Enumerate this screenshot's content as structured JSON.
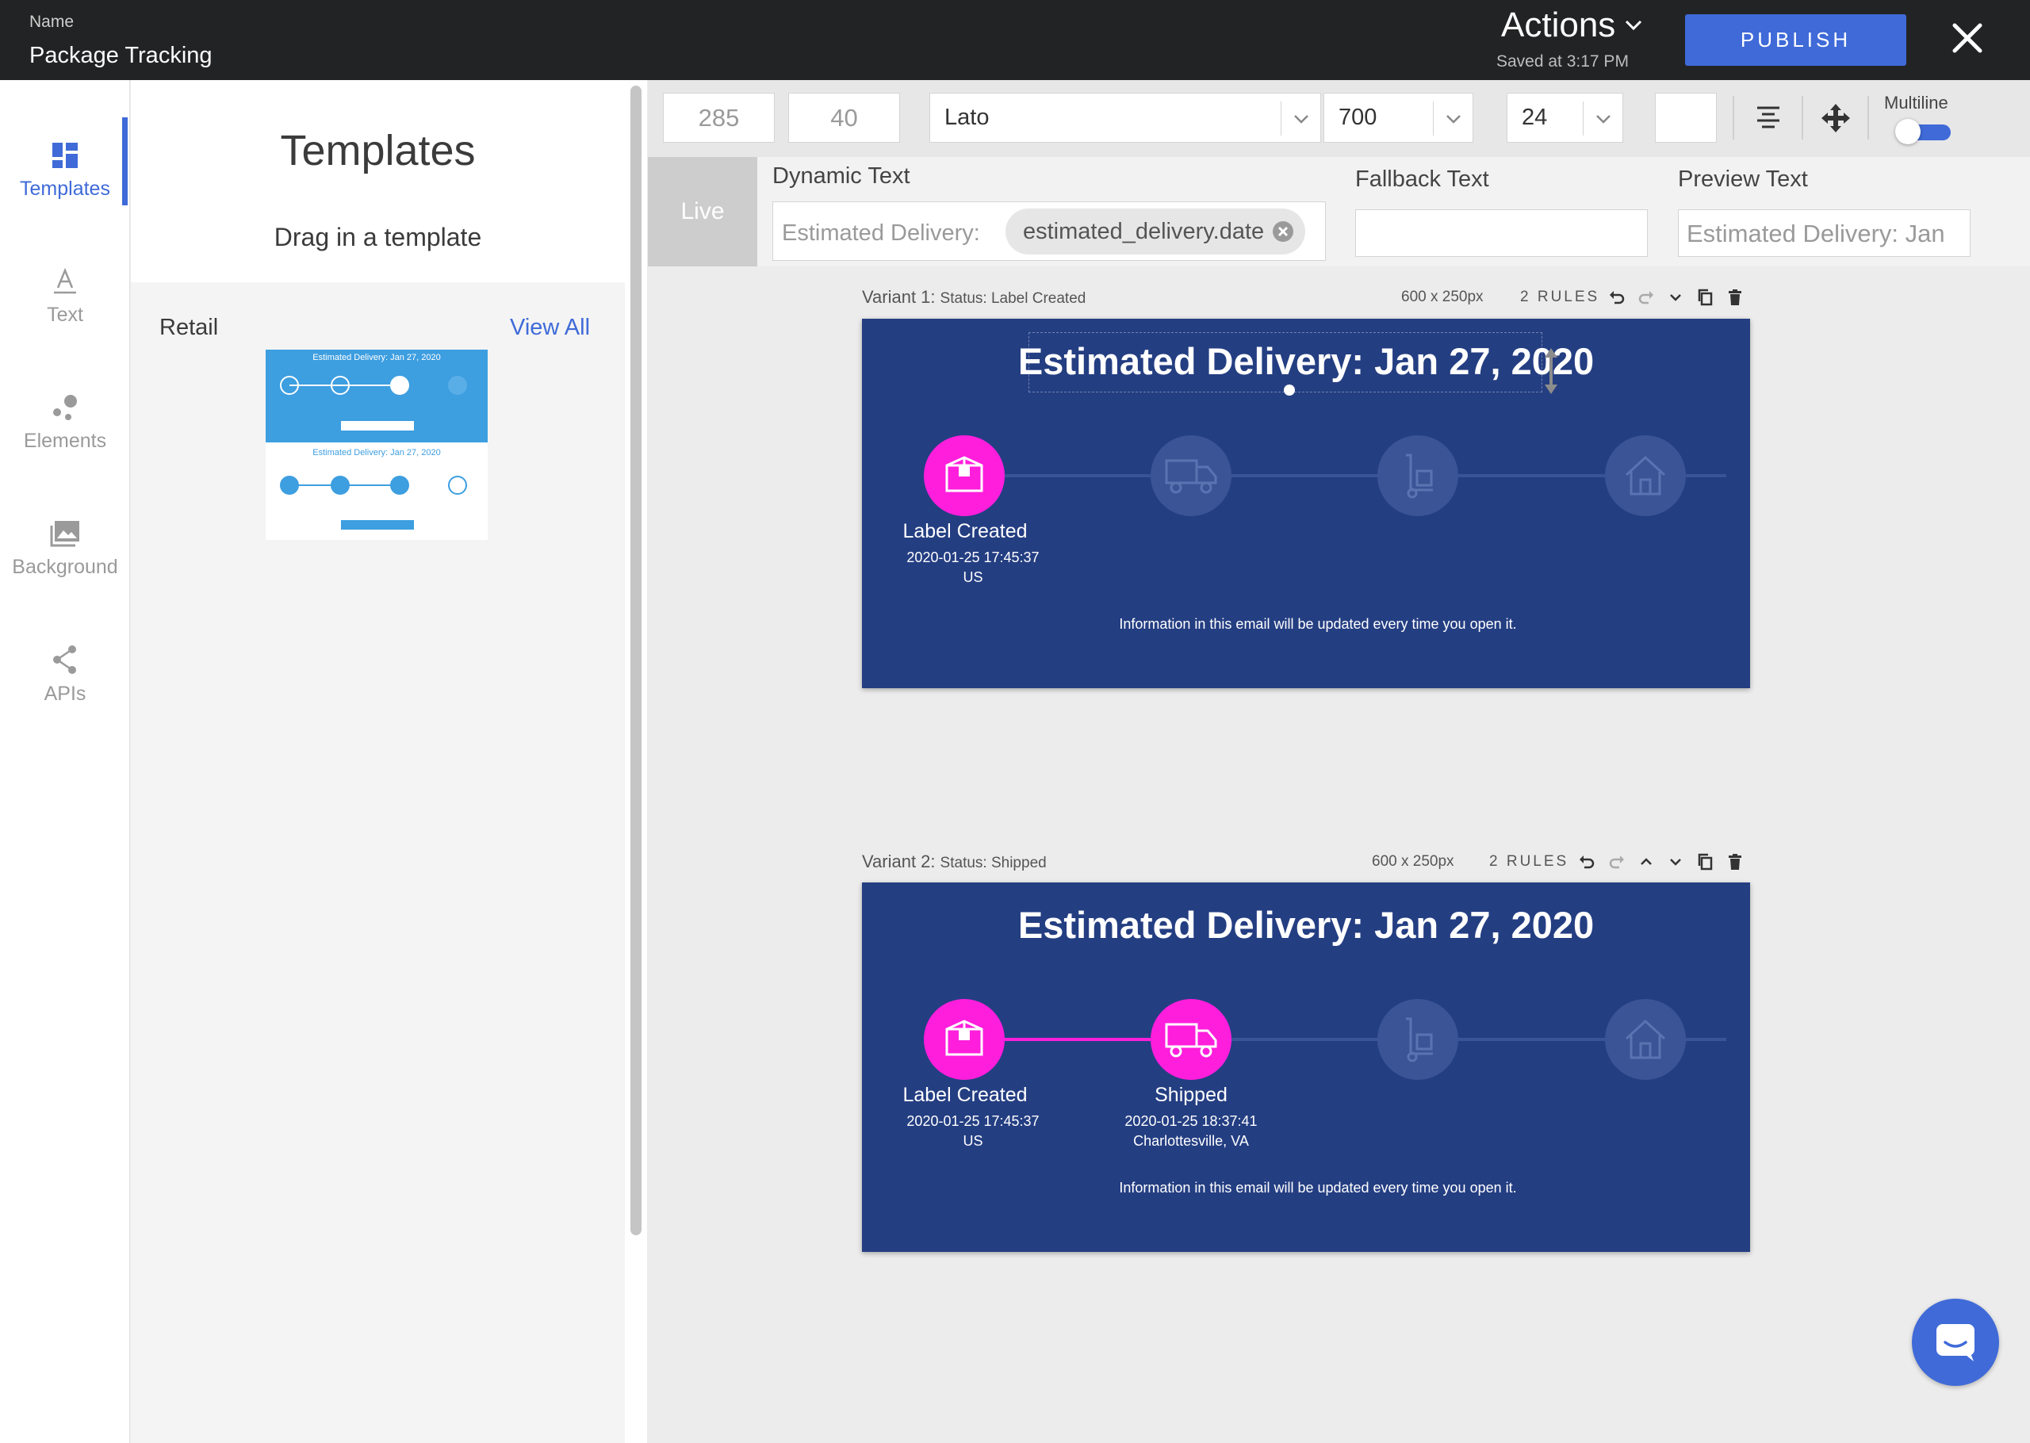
{
  "header": {
    "name_label": "Name",
    "project_name": "Package Tracking",
    "actions_label": "Actions",
    "saved_text": "Saved at 3:17 PM",
    "publish_label": "PUBLISH"
  },
  "nav": {
    "items": [
      {
        "label": "Templates",
        "icon": "grid-icon",
        "active": true
      },
      {
        "label": "Text",
        "icon": "text-icon"
      },
      {
        "label": "Elements",
        "icon": "shapes-icon"
      },
      {
        "label": "Background",
        "icon": "image-icon"
      },
      {
        "label": "APIs",
        "icon": "share-icon"
      }
    ]
  },
  "templates_panel": {
    "title": "Templates",
    "subtitle": "Drag in a template",
    "category": "Retail",
    "view_all": "View All",
    "thumb_title_1": "Estimated Delivery: Jan 27, 2020",
    "thumb_title_2": "Estimated Delivery: Jan 27, 2020"
  },
  "toolbar": {
    "width": "285",
    "height": "40",
    "font_family": "Lato",
    "font_weight": "700",
    "font_size": "24",
    "text_color": "#ffffff",
    "multiline_label": "Multiline",
    "multiline_on": true
  },
  "dynamic_text": {
    "live_label": "Live",
    "label": "Dynamic Text",
    "prefix": "Estimated Delivery:",
    "token": "estimated_delivery.date",
    "fallback_label": "Fallback Text",
    "fallback_value": "",
    "preview_label": "Preview Text",
    "preview_value": "Estimated Delivery: Jan"
  },
  "variants": [
    {
      "name": "Variant 1:",
      "status": "Status: Label Created",
      "dimensions": "600 x 250px",
      "rules": "2 RULES",
      "title": "Estimated Delivery: Jan 27, 2020",
      "footer": "Information in this email will be updated every time you open it.",
      "steps": [
        {
          "label": "Label Created",
          "timestamp": "2020-01-25 17:45:37",
          "location": "US",
          "done": true,
          "icon": "package-icon"
        },
        {
          "label": "",
          "timestamp": "",
          "location": "",
          "done": false,
          "icon": "truck-icon"
        },
        {
          "label": "",
          "timestamp": "",
          "location": "",
          "done": false,
          "icon": "dolly-icon"
        },
        {
          "label": "",
          "timestamp": "",
          "location": "",
          "done": false,
          "icon": "house-icon"
        }
      ]
    },
    {
      "name": "Variant 2:",
      "status": "Status: Shipped",
      "dimensions": "600 x 250px",
      "rules": "2 RULES",
      "title": "Estimated Delivery: Jan 27, 2020",
      "footer": "Information in this email will be updated every time you open it.",
      "steps": [
        {
          "label": "Label Created",
          "timestamp": "2020-01-25 17:45:37",
          "location": "US",
          "done": true,
          "icon": "package-icon"
        },
        {
          "label": "Shipped",
          "timestamp": "2020-01-25 18:37:41",
          "location": "Charlottesville, VA",
          "done": true,
          "icon": "truck-icon"
        },
        {
          "label": "",
          "timestamp": "",
          "location": "",
          "done": false,
          "icon": "dolly-icon"
        },
        {
          "label": "",
          "timestamp": "",
          "location": "",
          "done": false,
          "icon": "house-icon"
        }
      ]
    }
  ],
  "colors": {
    "accent": "#3f6ad8",
    "canvas_bg": "#243e82",
    "done_step": "#ff1edc",
    "pending_step": "#3a5496",
    "header_bg": "#222324"
  }
}
